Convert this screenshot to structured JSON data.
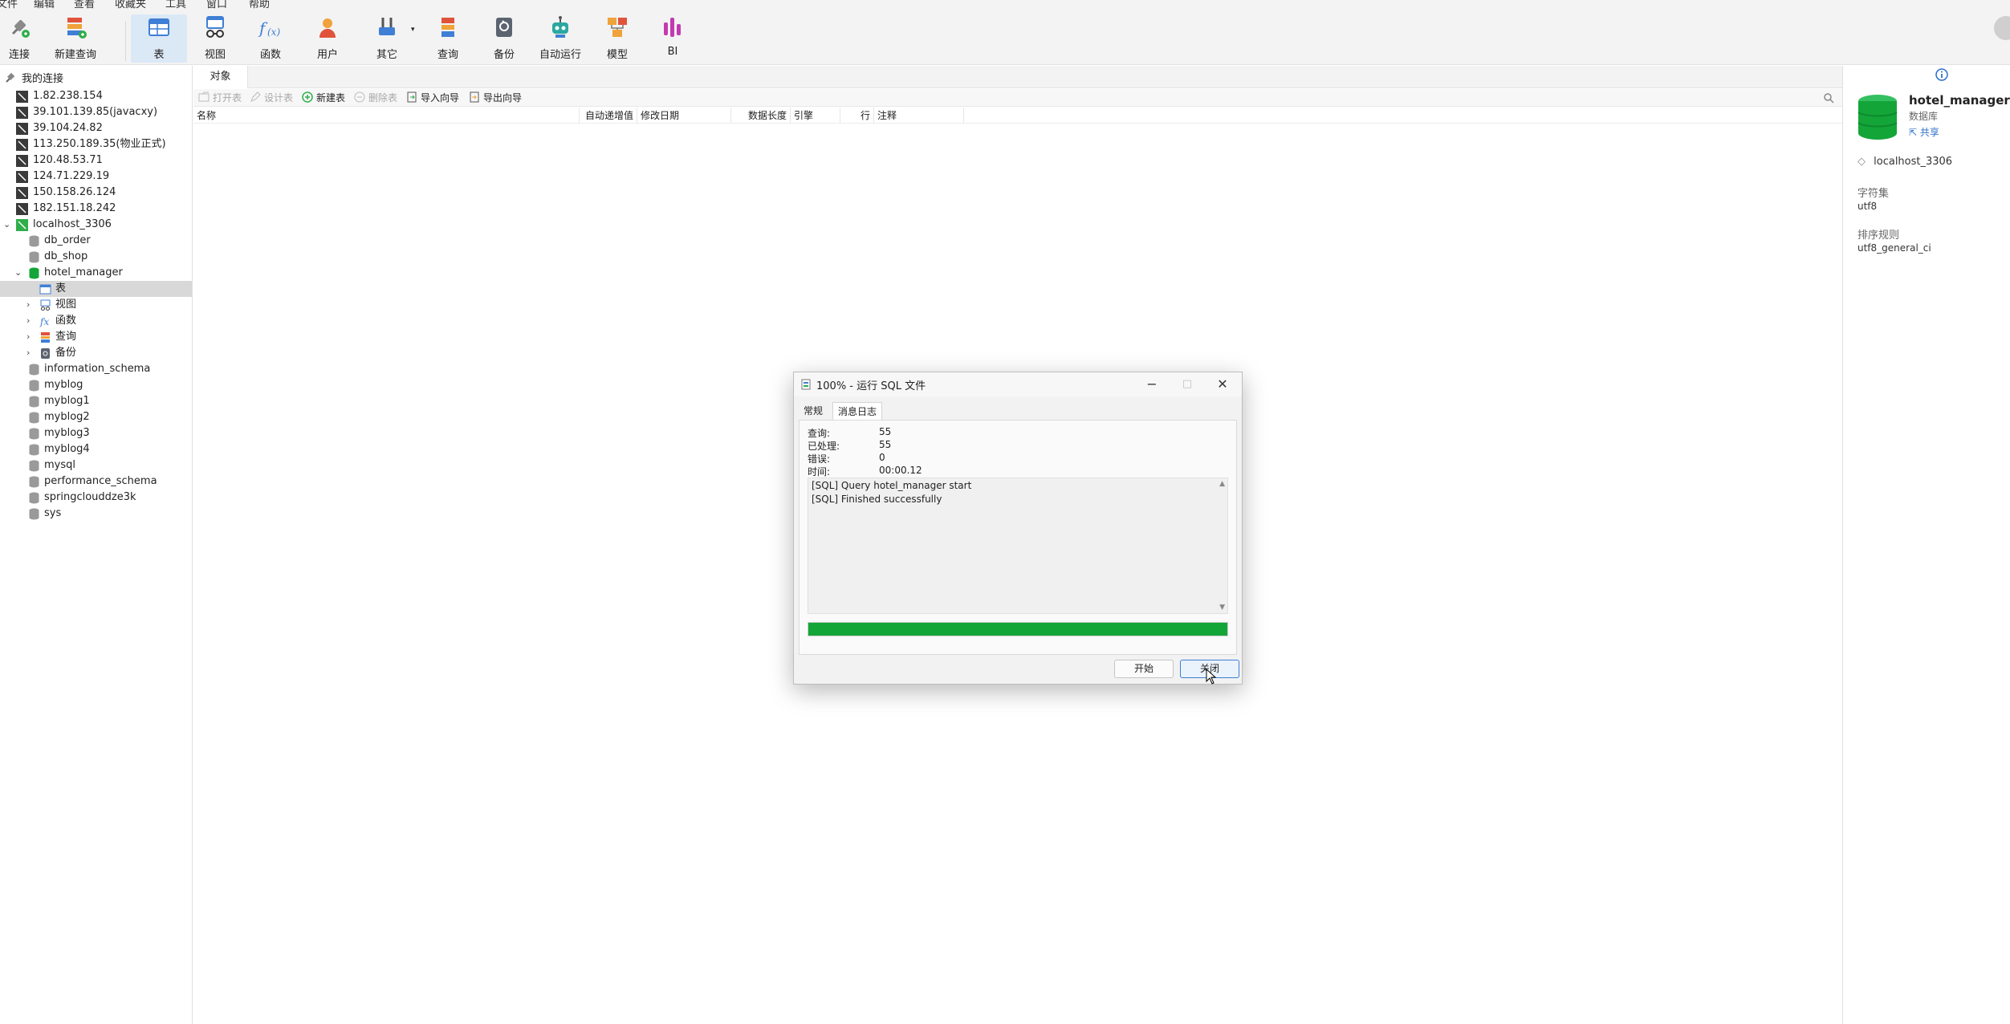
{
  "menu": [
    "文件",
    "编辑",
    "查看",
    "收藏夹",
    "工具",
    "窗口",
    "帮助"
  ],
  "toolbar": {
    "connect": "连接",
    "new_query": "新建查询",
    "table": "表",
    "view": "视图",
    "function": "函数",
    "user": "用户",
    "other": "其它",
    "query": "查询",
    "backup": "备份",
    "automation": "自动运行",
    "model": "模型",
    "bi": "BI"
  },
  "tree": {
    "header": "我的连接",
    "connections": [
      "1.82.238.154",
      "39.101.139.85(javacxy)",
      "39.104.24.82",
      "113.250.189.35(物业正式)",
      "120.48.53.71",
      "124.71.229.19",
      "150.158.26.124",
      "182.151.18.242"
    ],
    "local": "localhost_3306",
    "dbs_before": [
      "db_order",
      "db_shop"
    ],
    "open_db": "hotel_manager",
    "open_db_children": [
      "表",
      "视图",
      "函数",
      "查询",
      "备份"
    ],
    "dbs_after": [
      "information_schema",
      "myblog",
      "myblog1",
      "myblog2",
      "myblog3",
      "myblog4",
      "mysql",
      "performance_schema",
      "springclouddze3k",
      "sys"
    ]
  },
  "main": {
    "tab": "对象",
    "actions": [
      "打开表",
      "设计表",
      "新建表",
      "删除表",
      "导入向导",
      "导出向导"
    ],
    "columns": [
      "名称",
      "自动递增值",
      "修改日期",
      "数据长度",
      "引擎",
      "行",
      "注释"
    ]
  },
  "info": {
    "name": "hotel_manager",
    "type": "数据库",
    "share": "共享",
    "connection": "localhost_3306",
    "charset_label": "字符集",
    "charset": "utf8",
    "collation_label": "排序规则",
    "collation": "utf8_general_ci"
  },
  "dialog": {
    "title": "100% - 运行 SQL 文件",
    "tabs": [
      "常规",
      "消息日志"
    ],
    "stats": [
      {
        "label": "查询:",
        "value": "55"
      },
      {
        "label": "已处理:",
        "value": "55"
      },
      {
        "label": "错误:",
        "value": "0"
      },
      {
        "label": "时间:",
        "value": "00:00.12"
      }
    ],
    "log": [
      "[SQL] Query hotel_manager start",
      "[SQL] Finished successfully"
    ],
    "progress": 1.0,
    "start": "开始",
    "close": "关闭"
  },
  "colors": {
    "progress": "#13a538",
    "db_green": "#13a538",
    "accent": "#2f6fc9"
  }
}
